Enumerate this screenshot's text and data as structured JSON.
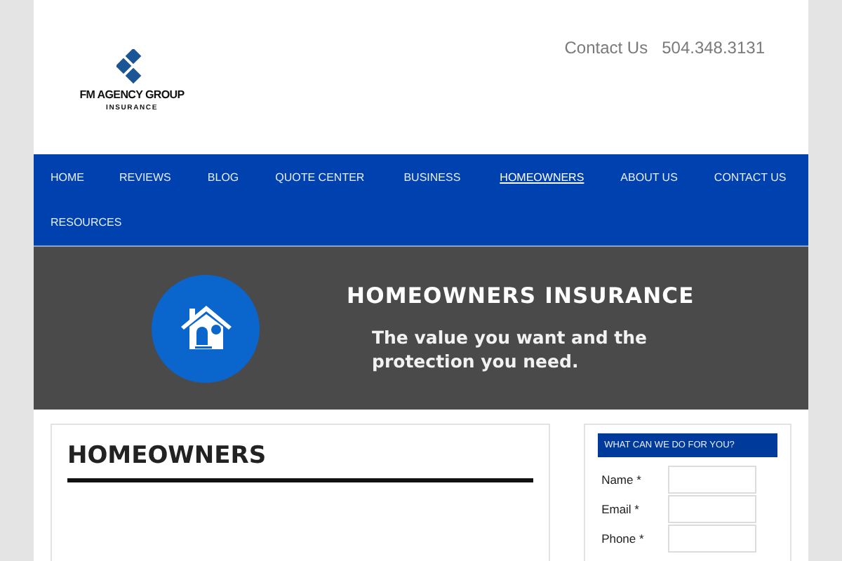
{
  "header": {
    "logo": {
      "name": "FM AGENCY GROUP",
      "tagline": "INSURANCE"
    },
    "links": [
      {
        "text": "Contact Us"
      },
      {
        "text": "504.348.3131"
      }
    ]
  },
  "nav": {
    "rows": [
      [
        {
          "label": "HOME",
          "selected": false
        },
        {
          "label": "REVIEWS",
          "selected": false
        },
        {
          "label": "BLOG",
          "selected": false
        },
        {
          "label": "QUOTE CENTER",
          "selected": false
        },
        {
          "label": "BUSINESS",
          "selected": false
        },
        {
          "label": "HOMEOWNERS",
          "selected": true
        },
        {
          "label": "ABOUT US",
          "selected": false
        },
        {
          "label": "CONTACT US",
          "selected": false
        }
      ],
      [
        {
          "label": "RESOURCES",
          "selected": false
        }
      ]
    ]
  },
  "banner": {
    "title": "HOMEOWNERS INSURANCE",
    "subtitle": "The value you want and the protection you need."
  },
  "content": {
    "title": "HOMEOWNERS"
  },
  "sidebar": {
    "heading": "WHAT CAN WE DO FOR YOU?",
    "fields": [
      {
        "label": "Name *"
      },
      {
        "label": "Email *"
      },
      {
        "label": "Phone *"
      }
    ]
  }
}
